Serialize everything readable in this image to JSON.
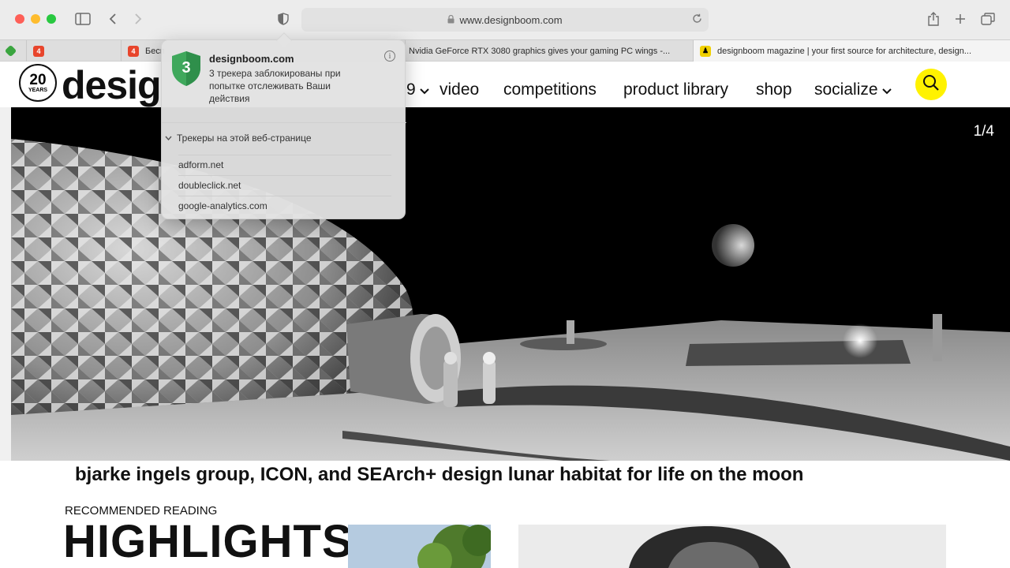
{
  "browser": {
    "url": "www.designboom.com",
    "tabs": [
      {
        "label": "",
        "favicon_color": "#3aa53f"
      },
      {
        "label": "",
        "favicon_color": "#e8452c"
      },
      {
        "label": "Бесп",
        "favicon_color": "#e8452c"
      },
      {
        "label": "Nvidia GeForce RTX 3080 graphics gives your gaming PC wings -...",
        "favicon_color": "#555555"
      },
      {
        "label": "designboom magazine | your first source for architecture, design...",
        "favicon_color": "#f0d000"
      }
    ]
  },
  "site": {
    "logo_years": "20",
    "logo_years_label": "YEARS",
    "logo_word": "desig",
    "nav": [
      {
        "label": "9"
      },
      {
        "label": "video"
      },
      {
        "label": "competitions"
      },
      {
        "label": "product library"
      },
      {
        "label": "shop"
      },
      {
        "label": "socialize"
      }
    ],
    "accent": "#fff200"
  },
  "hero": {
    "counter": "1/4",
    "caption": "bjarke ingels group, ICON, and SEArch+ design lunar habitat for life on the moon"
  },
  "recommended": {
    "label": "RECOMMENDED READING",
    "title": "HIGHLIGHTS"
  },
  "tracker_popover": {
    "count": "3",
    "site": "designboom.com",
    "message": "3 трекера заблокированы при попытке отслеживать Ваши действия",
    "section_title": "Трекеры на этой веб-странице",
    "trackers": [
      "adform.net",
      "doubleclick.net",
      "google-analytics.com"
    ],
    "shield_color": "#3fa85c"
  }
}
